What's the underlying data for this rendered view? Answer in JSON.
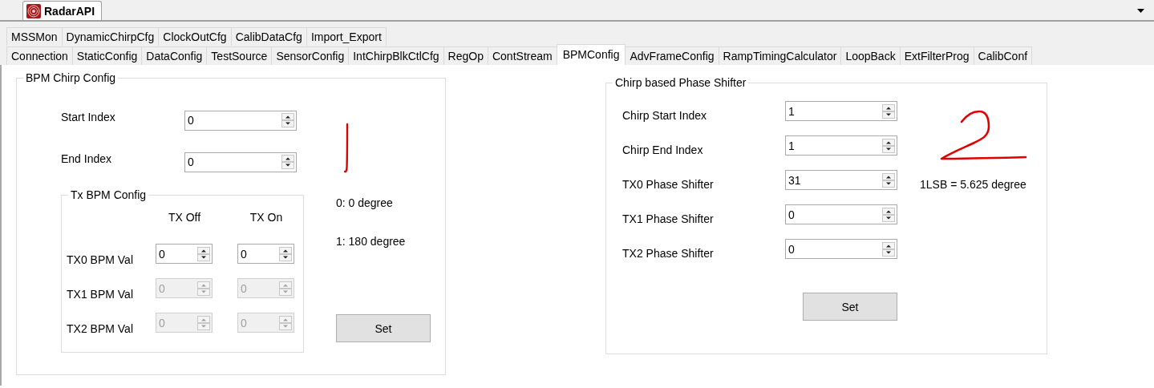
{
  "document_tab": {
    "title": "RadarAPI",
    "selected": true
  },
  "tab_rows": [
    [
      {
        "label": "MSSMon",
        "selected": false
      },
      {
        "label": "DynamicChirpCfg",
        "selected": false
      },
      {
        "label": "ClockOutCfg",
        "selected": false
      },
      {
        "label": "CalibDataCfg",
        "selected": false
      },
      {
        "label": "Import_Export",
        "selected": false
      }
    ],
    [
      {
        "label": "Connection",
        "selected": false
      },
      {
        "label": "StaticConfig",
        "selected": false
      },
      {
        "label": "DataConfig",
        "selected": false
      },
      {
        "label": "TestSource",
        "selected": false
      },
      {
        "label": "SensorConfig",
        "selected": false
      },
      {
        "label": "IntChirpBlkCtlCfg",
        "selected": false
      },
      {
        "label": "RegOp",
        "selected": false
      },
      {
        "label": "ContStream",
        "selected": false
      },
      {
        "label": "BPMConfig",
        "selected": true
      },
      {
        "label": "AdvFrameConfig",
        "selected": false
      },
      {
        "label": "RampTimingCalculator",
        "selected": false
      },
      {
        "label": "LoopBack",
        "selected": false
      },
      {
        "label": "ExtFilterProg",
        "selected": false
      },
      {
        "label": "CalibConf",
        "selected": false
      }
    ]
  ],
  "bpm_chirp_config": {
    "title": "BPM Chirp Config",
    "fields": [
      {
        "label": "Start Index",
        "value": "0",
        "disabled": false
      },
      {
        "label": "End Index",
        "value": "0",
        "disabled": false
      }
    ],
    "tx_bpm_config": {
      "title": "Tx BPM Config",
      "columns": [
        "TX Off",
        "TX On"
      ],
      "rows": [
        {
          "label": "TX0 BPM Val",
          "values": [
            {
              "value": "0",
              "disabled": false
            },
            {
              "value": "0",
              "disabled": false
            }
          ]
        },
        {
          "label": "TX1 BPM Val",
          "values": [
            {
              "value": "0",
              "disabled": true
            },
            {
              "value": "0",
              "disabled": true
            }
          ]
        },
        {
          "label": "TX2 BPM Val",
          "values": [
            {
              "value": "0",
              "disabled": true
            },
            {
              "value": "0",
              "disabled": true
            }
          ]
        }
      ]
    },
    "notes": [
      "0: 0 degree",
      "1: 180 degree"
    ],
    "button": "Set"
  },
  "phase_shifter": {
    "title": "Chirp based Phase Shifter",
    "fields": [
      {
        "label": "Chirp Start Index",
        "value": "1",
        "disabled": false
      },
      {
        "label": "Chirp End Index",
        "value": "1",
        "disabled": false
      },
      {
        "label": "TX0 Phase Shifter",
        "value": "31",
        "disabled": false
      },
      {
        "label": "TX1 Phase Shifter",
        "value": "0",
        "disabled": false
      },
      {
        "label": "TX2 Phase Shifter",
        "value": "0",
        "disabled": false
      }
    ],
    "note": "1LSB = 5.625 degree",
    "button": "Set"
  }
}
